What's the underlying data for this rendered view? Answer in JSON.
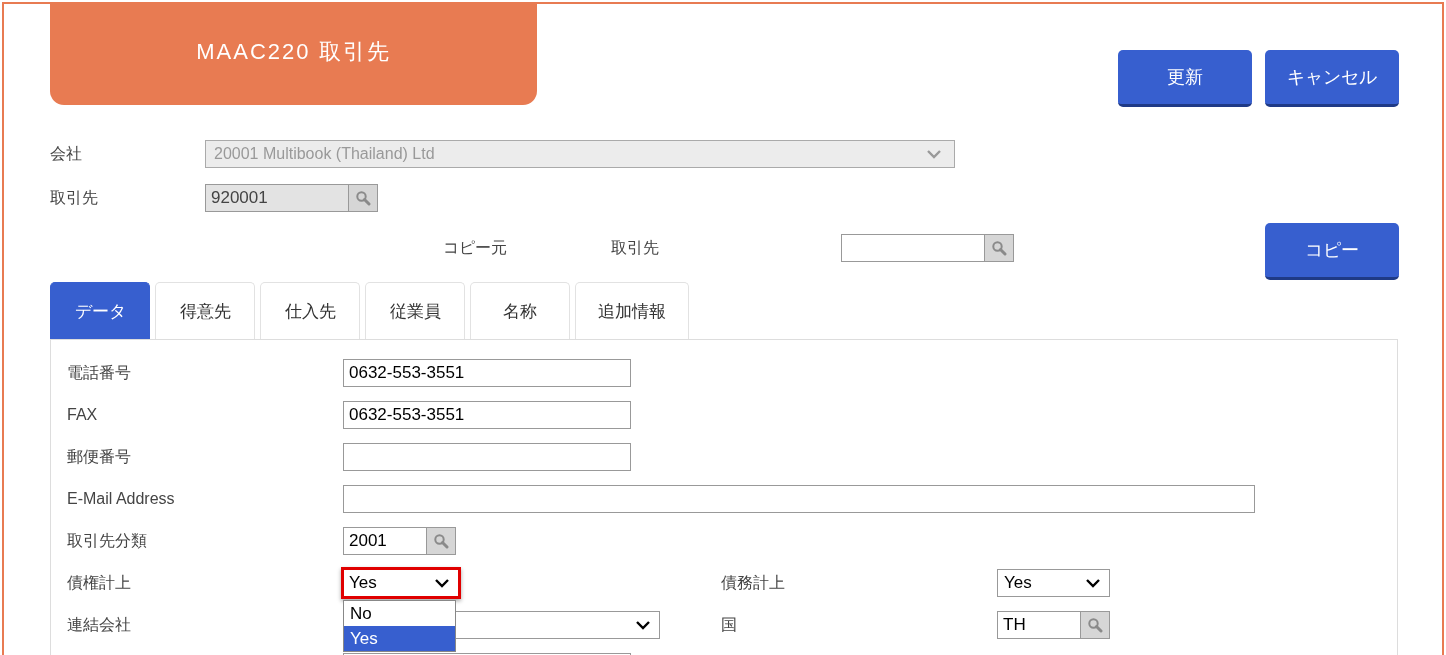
{
  "header": {
    "title": "MAAC220 取引先"
  },
  "actions": [
    {
      "label": "更新"
    },
    {
      "label": "キャンセル"
    }
  ],
  "company": {
    "label": "会社",
    "value": "20001 Multibook (Thailand) Ltd",
    "disabled": true
  },
  "partner": {
    "label": "取引先",
    "value": "920001",
    "disabled": true
  },
  "copy": {
    "label": "コピー元",
    "field_label": "取引先",
    "button": "コピー"
  },
  "tabs": [
    {
      "label": "データ",
      "selected": true
    },
    {
      "label": "得意先",
      "selected": false
    },
    {
      "label": "仕入先",
      "selected": false
    },
    {
      "label": "従業員",
      "selected": false
    },
    {
      "label": "名称",
      "selected": false
    },
    {
      "label": "追加情報",
      "selected": false
    }
  ],
  "form": {
    "rows": [
      {
        "fields": [
          {
            "label": "電話番号",
            "kind": "text",
            "value": "0632-553-3551"
          }
        ]
      },
      {
        "fields": [
          {
            "label": "FAX",
            "kind": "text",
            "value": "0632-553-3551"
          }
        ]
      },
      {
        "fields": [
          {
            "label": "郵便番号",
            "kind": "text"
          }
        ]
      },
      {
        "fields": [
          {
            "label": "E-Mail Address",
            "kind": "email"
          }
        ]
      },
      {
        "fields": [
          {
            "label": "取引先分類",
            "kind": "lookup",
            "value": "2001"
          }
        ]
      },
      {
        "fields": [
          {
            "label": "債権計上",
            "kind": "select",
            "value": "Yes",
            "highlighted": true,
            "open": true,
            "options": [
              {
                "label": "No",
                "selected": false
              },
              {
                "label": "Yes",
                "selected": true
              }
            ]
          },
          {
            "label": "債務計上",
            "kind": "select",
            "value": "Yes",
            "highlighted": false,
            "open": false
          }
        ]
      },
      {
        "fields": [
          {
            "label": "連結会社",
            "kind": "select",
            "highlighted": false,
            "open": false
          },
          {
            "label": "国",
            "kind": "lookup",
            "value": "TH"
          }
        ]
      },
      {
        "fields": [
          {
            "kind": "text"
          }
        ]
      }
    ]
  }
}
